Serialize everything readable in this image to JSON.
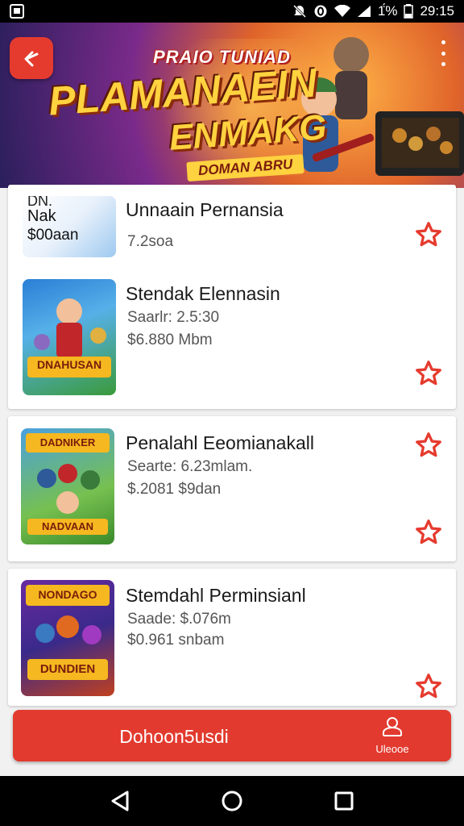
{
  "status_bar": {
    "battery_text": "1̈́%",
    "time": "29:15"
  },
  "banner": {
    "top_text": "PRAIO TUNIAD",
    "title_line1": "PLAMANAEIN",
    "title_line2": "ENMAKG",
    "subtitle": "DOMAN ABRU"
  },
  "cards": [
    {
      "thumb_text_top": "DN.",
      "thumb_text_mid": "Nak",
      "thumb_text_bot": "$00aan",
      "title": "Unnaain Pernansia",
      "meta1": "7.2soa",
      "meta2": ""
    },
    {
      "thumb_text": "DNAHUSAN",
      "title": "Stendak Elennasin",
      "meta1": "Saarlr: 2.5:30",
      "meta2": "$6.880 Mbm"
    },
    {
      "thumb_text": "DADNIKER",
      "thumb_text2": "NADVAAN",
      "title": "Penalahl Eeomianakall",
      "meta1": "Searte: 6.23mlam.",
      "meta2": "$.2081 $9dan"
    },
    {
      "thumb_text": "NONDAGO",
      "thumb_text2": "DUNDIEN",
      "title": "Stemdahl Perminsianl",
      "meta1": "Saade: $.076m",
      "meta2": "$0.961 snbam"
    }
  ],
  "bottom_button": {
    "label": "Dohoon5usdi",
    "right_label": "Uleooe"
  },
  "colors": {
    "accent": "#e23a2e",
    "star": "#e53b2f"
  }
}
